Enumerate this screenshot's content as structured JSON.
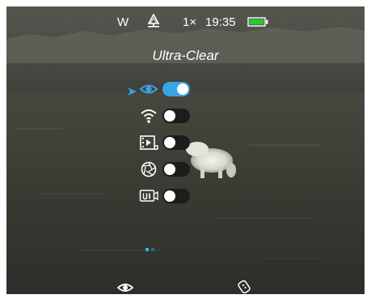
{
  "status_bar": {
    "mode_letter": "W",
    "mode_icon": "forest-mode-icon",
    "zoom": "1×",
    "time": "19:35",
    "battery_icon": "battery-full-icon",
    "battery_color": "#2ec42e"
  },
  "mode_title": "Ultra-Clear",
  "settings_menu": {
    "accent_color": "#3aa3e3",
    "items": [
      {
        "icon": "eye-icon",
        "selected": true,
        "enabled": true
      },
      {
        "icon": "wifi-icon",
        "selected": false,
        "enabled": false
      },
      {
        "icon": "video-record-icon",
        "selected": false,
        "enabled": false
      },
      {
        "icon": "aperture-icon",
        "selected": false,
        "enabled": false
      },
      {
        "icon": "ui-display-icon",
        "selected": false,
        "enabled": false
      }
    ]
  },
  "page_indicator": {
    "current": 1,
    "total": 2
  },
  "bottom_bar": {
    "left_icon": "eye-icon",
    "right_icon": "remote-control-icon"
  }
}
